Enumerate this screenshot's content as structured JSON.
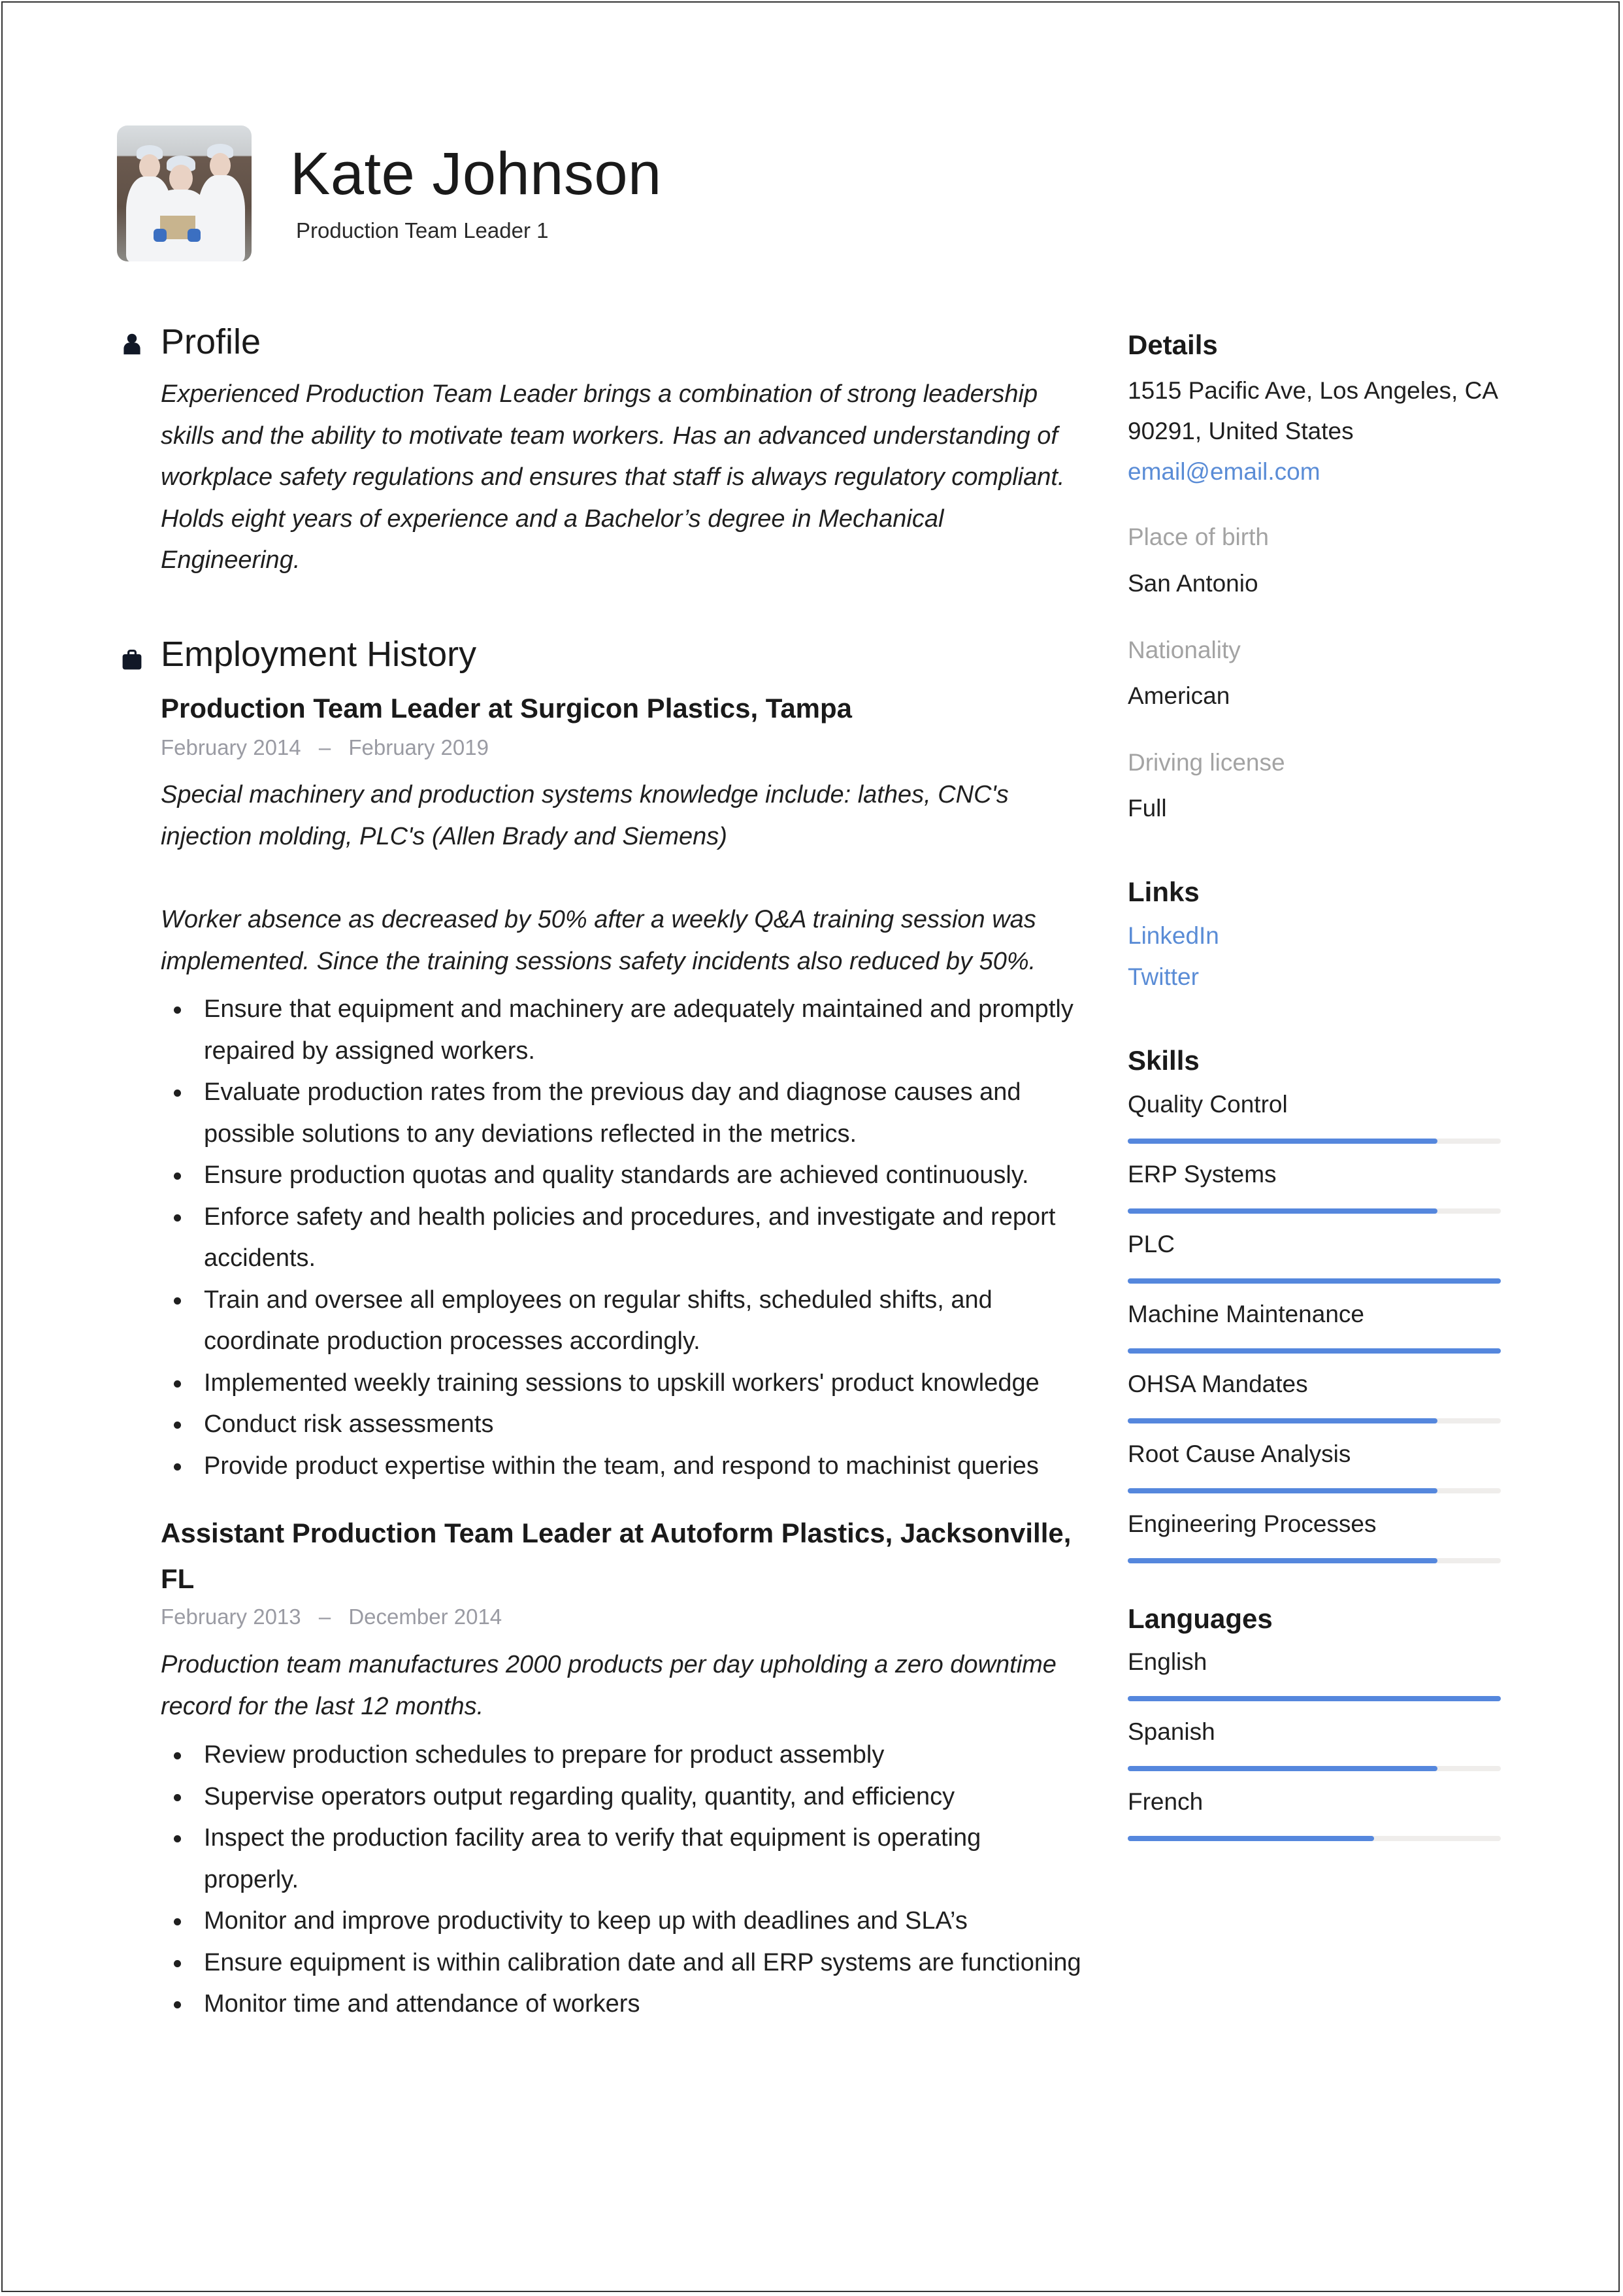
{
  "header": {
    "name": "Kate Johnson",
    "subtitle": "Production Team Leader 1",
    "photo_icon": "profile-photo"
  },
  "profile": {
    "heading": "Profile",
    "icon": "person-icon",
    "text": "Experienced Production Team Leader brings a combination of strong leadership skills and the ability to motivate team workers. Has an advanced understanding of workplace safety regulations and ensures that staff is always regulatory compliant. Holds eight years of experience and a Bachelor’s degree in Mechanical Engineering."
  },
  "employment": {
    "heading": "Employment History",
    "icon": "briefcase-icon",
    "jobs": [
      {
        "title": "Production Team Leader at Surgicon Plastics, Tampa",
        "start": "February 2014",
        "end": "February 2019",
        "separator": "–",
        "description": [
          "Special machinery and production systems knowledge include: lathes, CNC's injection molding, PLC's (Allen Brady and Siemens)",
          "Worker absence as decreased by 50% after a weekly Q&A training session was implemented. Since the training sessions safety incidents also reduced by 50%."
        ],
        "bullets": [
          "Ensure that equipment and machinery are adequately maintained and promptly repaired by assigned workers.",
          "Evaluate production rates from the previous day and diagnose causes and possible solutions to any deviations reflected in the metrics.",
          "Ensure production quotas and quality standards are achieved continuously.",
          "Enforce safety and health policies and procedures, and investigate and report accidents.",
          "Train and oversee all employees on regular shifts, scheduled shifts, and coordinate production processes accordingly.",
          "Implemented weekly training sessions to upskill workers' product knowledge",
          "Conduct risk assessments",
          "Provide product expertise within the team, and respond to machinist queries"
        ]
      },
      {
        "title": "Assistant Production Team Leader at Autoform Plastics, Jacksonville, FL",
        "start": "February 2013",
        "end": "December 2014",
        "separator": "–",
        "description": [
          "Production team manufactures 2000 products per day upholding a zero downtime record for the last 12 months."
        ],
        "bullets": [
          "Review production schedules to prepare for product assembly",
          "Supervise operators output regarding quality, quantity, and efficiency",
          "Inspect the production facility area to verify that equipment is operating properly.",
          "Monitor and improve productivity to keep up with deadlines and SLA’s",
          "Ensure equipment is within calibration date and all ERP systems are functioning",
          "Monitor time and attendance of workers"
        ]
      }
    ]
  },
  "details": {
    "heading": "Details",
    "address_line1": "1515 Pacific Ave, Los Angeles, CA",
    "address_line2": "90291, United States",
    "email": "email@email.com",
    "place_of_birth_label": "Place of birth",
    "place_of_birth": "San Antonio",
    "nationality_label": "Nationality",
    "nationality": "American",
    "driving_license_label": "Driving license",
    "driving_license": "Full"
  },
  "links": {
    "heading": "Links",
    "items": [
      "LinkedIn",
      "Twitter"
    ]
  },
  "skills": {
    "heading": "Skills",
    "items": [
      {
        "name": "Quality Control",
        "level": 0.83
      },
      {
        "name": "ERP Systems",
        "level": 0.83
      },
      {
        "name": "PLC",
        "level": 1.0
      },
      {
        "name": "Machine Maintenance",
        "level": 1.0
      },
      {
        "name": "OHSA Mandates",
        "level": 0.83
      },
      {
        "name": "Root Cause Analysis",
        "level": 0.83
      },
      {
        "name": "Engineering Processes",
        "level": 0.83
      }
    ]
  },
  "languages": {
    "heading": "Languages",
    "items": [
      {
        "name": "English",
        "level": 1.0
      },
      {
        "name": "Spanish",
        "level": 0.83
      },
      {
        "name": "French",
        "level": 0.66
      }
    ]
  },
  "colors": {
    "accent": "#5587dd",
    "link": "#5a8cd6",
    "muted": "#9a9ba3",
    "bar_track": "#efedeb"
  }
}
